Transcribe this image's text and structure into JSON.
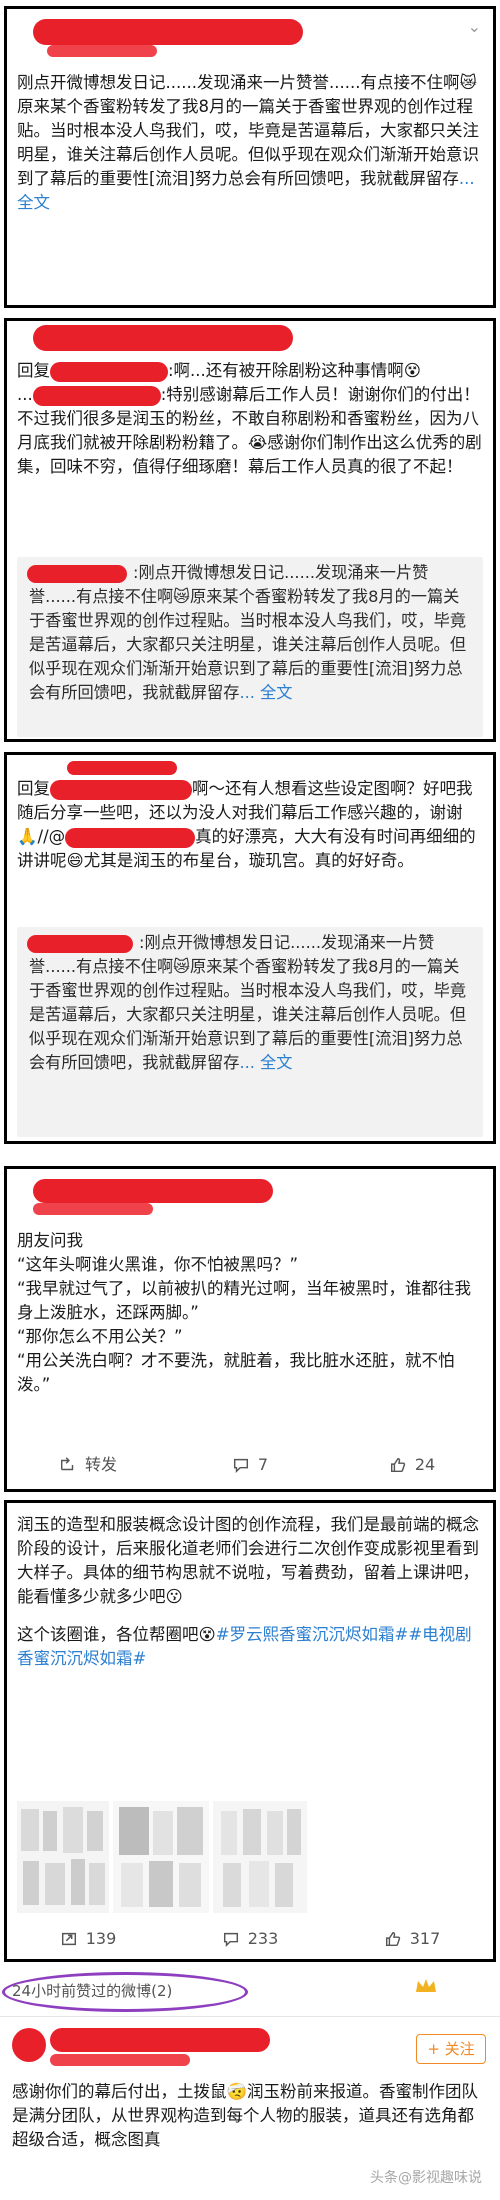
{
  "ui": {
    "chevron": "⌄",
    "quote_leading_blank": "",
    "emoji_colors": {
      "shock": "#f2b21f",
      "laugh": "#f4b626",
      "cry": "#5aa2e8",
      "doubt": "#f2c12e"
    }
  },
  "post1": {
    "text": "刚点开微博想发日记......发现涌来一片赞誉......有点接不住啊😿原来某个香蜜粉转发了我8月的一篇关于香蜜世界观的创作过程贴。当时根本没人鸟我们，哎，毕竟是苦逼幕后，大家都只关注明星，谁关注幕后创作人员呢。但似乎现在观众们渐渐开始意识到了幕后的重要性[流泪]努力总会有所回馈吧，我就截屏留存",
    "more": "... 全文"
  },
  "post2": {
    "reply_prefix": "回复",
    "reply_text": ":啊...还有被开除剧粉这种事情啊😵",
    "line2": "...",
    "line2b": ":特别感谢幕后工作人员！谢谢你们的付出！不过我们很多是润玉的粉丝，不敢自称剧粉和香蜜粉丝，因为八月底我们就被开除剧粉粉籍了。😭感谢你们制作出这么优秀的剧集，回味不穷，值得仔细琢磨！幕后工作人员真的很了不起！",
    "quote_text": ":刚点开微博想发日记......发现涌来一片赞誉......有点接不住啊😿原来某个香蜜粉转发了我8月的一篇关于香蜜世界观的创作过程贴。当时根本没人鸟我们，哎，毕竟是苦逼幕后，大家都只关注明星，谁关注幕后创作人员呢。但似乎现在观众们渐渐开始意识到了幕后的重要性[流泪]努力总会有所回馈吧，我就截屏留存",
    "more": "... 全文"
  },
  "post3": {
    "reply_prefix": "回复",
    "reply_text": "啊～还有人想看这些设定图啊？好吧我随后分享一些吧，还以为没人对我们幕后工作感兴趣的，谢谢🙏//@",
    "reply_text2": "真的好漂亮，大大有没有时间再细细的讲讲呢😄尤其是润玉的布星台，璇玑宫。真的好好奇。",
    "quote_text": ":刚点开微博想发日记......发现涌来一片赞誉......有点接不住啊😿原来某个香蜜粉转发了我8月的一篇关于香蜜世界观的创作过程贴。当时根本没人鸟我们，哎，毕竟是苦逼幕后，大家都只关注明星，谁关注幕后创作人员呢。但似乎现在观众们渐渐开始意识到了幕后的重要性[流泪]努力总会有所回馈吧，我就截屏留存",
    "more": "... 全文"
  },
  "post4": {
    "lines": [
      "朋友问我",
      "“这年头啊谁火黑谁，你不怕被黑吗？”",
      "“我早就过气了，以前被扒的精光过啊，当年被黑时，谁都往我身上泼脏水，还踩两脚。”",
      "“那你怎么不用公关？”",
      "“用公关洗白啊？才不要洗，就脏着，我比脏水还脏，就不怕泼。”"
    ],
    "repost_label": "转发",
    "comment_count": "7",
    "like_count": "24"
  },
  "post5": {
    "text": "润玉的造型和服装概念设计图的创作流程，我们是最前端的概念阶段的设计，后来服化道老师们会进行二次创作变成影视里看到大样子。具体的细节构思就不说啦，写着费劲，留着上课讲吧，能看懂多少就多少吧😗",
    "text2": "这个该圈谁，各位帮圈吧😵",
    "hashtags": "#罗云熙香蜜沉沉烬如霜##电视剧香蜜沉沉烬如霜#",
    "repost_count": "139",
    "comment_count": "233",
    "like_count": "317"
  },
  "post6": {
    "liked_header": "24小时前赞过的微博(2)",
    "follow_label": "+ 关注",
    "text": "感谢你们的幕后付出，土拨鼠🤕润玉粉前来报道。香蜜制作团队是满分团队，从世界观构造到每个人物的服装，道具还有选角都超级合适，概念图真",
    "watermark": "头条@影视趣味说"
  }
}
